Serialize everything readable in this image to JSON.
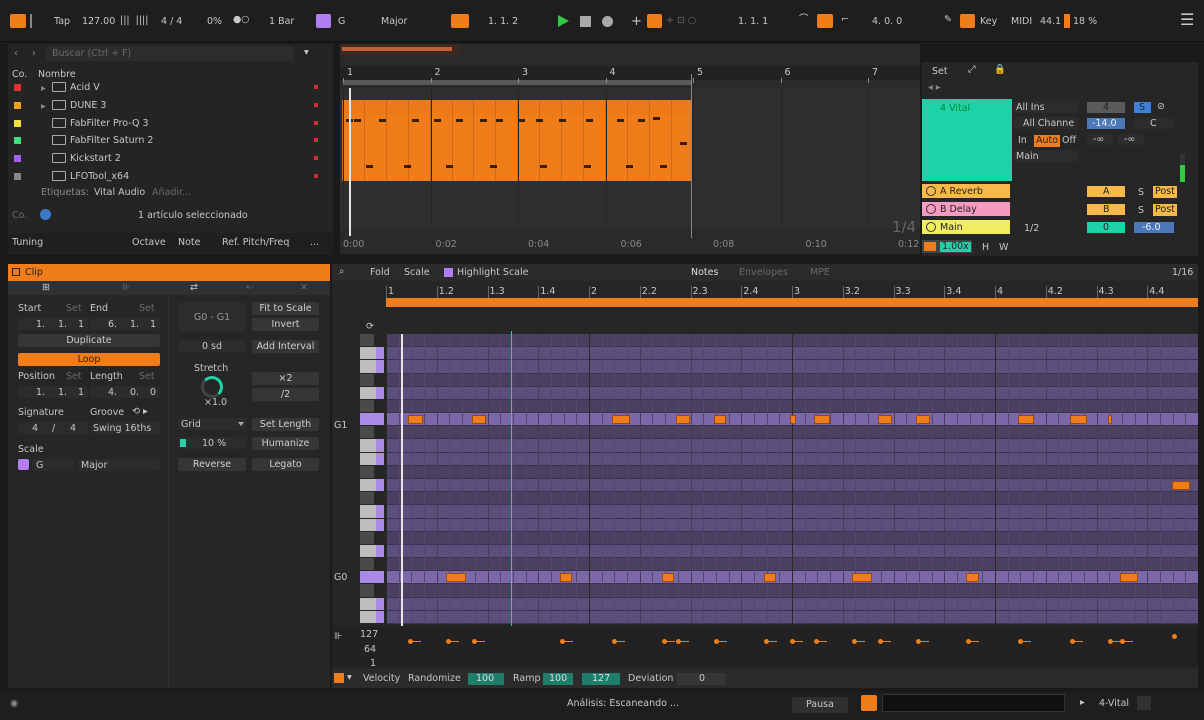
{
  "transport": {
    "tap": "Tap",
    "tempo": "127.00",
    "signature": "4 / 4",
    "swing": "0%",
    "quant": "1 Bar",
    "key_root": "G",
    "key_mode": "Major",
    "position": "1.  1.  2",
    "loop_start": "1.  1.  1",
    "loop_length": "4.  0.  0",
    "key_label": "Key",
    "midi_label": "MIDI",
    "sample_rate": "44.1",
    "cpu": "18 %"
  },
  "browser": {
    "search_placeholder": "Buscar (Ctrl + F)",
    "col_co": "Co.",
    "col_name": "Nombre",
    "items": [
      {
        "name": "Acid V",
        "color": "#e03030"
      },
      {
        "name": "DUNE 3",
        "color": "#f0a020"
      },
      {
        "name": "FabFilter Pro-Q 3",
        "color": "#f0e040"
      },
      {
        "name": "FabFilter Saturn 2",
        "color": "#40e080"
      },
      {
        "name": "Kickstart 2",
        "color": "#a060f0"
      },
      {
        "name": "LFOTool_x64",
        "color": "#888888"
      }
    ],
    "tags_label": "Etiquetas:",
    "tag": "Vital Audio",
    "tag_add": "Añadir...",
    "co2": "Co.",
    "selected": "1 artículo seleccionado",
    "tuning": "Tuning",
    "octave": "Octave",
    "note": "Note",
    "ref": "Ref. Pitch/Freq",
    "more": "..."
  },
  "arrangement": {
    "bars": [
      "1",
      "2",
      "3",
      "4",
      "5",
      "6",
      "7"
    ],
    "times": [
      "0:00",
      "0:02",
      "0:04",
      "0:06",
      "0:08",
      "0:10",
      "0:12"
    ],
    "quant": "1/4"
  },
  "mixer": {
    "set": "Set",
    "track": "4 Vital",
    "input": "All Ins",
    "channel": "All Channe",
    "in": "In",
    "auto": "Auto",
    "off": "Off",
    "out": "Main",
    "track_num": "4",
    "solo": "S",
    "vol": "-14.0",
    "pan": "C",
    "inf1": "-∞",
    "inf2": "-∞",
    "returns": [
      {
        "name": "A Reverb",
        "color": "#f6b94a",
        "send": "A",
        "send_color": "#f6b94a",
        "s": "S",
        "post": "Post"
      },
      {
        "name": "B Delay",
        "color": "#f79ac0",
        "send": "B",
        "send_color": "#f6b94a",
        "s": "S",
        "post": "Post"
      },
      {
        "name": "Main",
        "color": "#f0ee60",
        "send": "0",
        "send_color": "#1fd3a8",
        "s": "",
        "post": ""
      }
    ],
    "main_quant": "1/2",
    "main_vol": "-6.0",
    "speed": "1.00x",
    "h": "H",
    "w": "W"
  },
  "clip": {
    "title": "Clip",
    "start": "Start",
    "set": "Set",
    "end": "End",
    "start_val": [
      "1.",
      "1.",
      "1"
    ],
    "end_val": [
      "6.",
      "1.",
      "1"
    ],
    "duplicate": "Duplicate",
    "loop": "Loop",
    "position": "Position",
    "length": "Length",
    "position_val": [
      "1.",
      "1.",
      "1"
    ],
    "length_val": [
      "4.",
      "0.",
      "0"
    ],
    "signature": "Signature",
    "groove": "Groove",
    "sig_num": "4",
    "sig_den": "4",
    "groove_val": "Swing 16ths",
    "scale": "Scale",
    "scale_root": "G",
    "scale_mode": "Major",
    "range": "G0 - G1",
    "fit": "Fit to Scale",
    "invert": "Invert",
    "sd": "0 sd",
    "add_interval": "Add Interval",
    "stretch": "Stretch",
    "x2": "×2",
    "half": "/2",
    "stretch_val": "×1.0",
    "grid": "Grid",
    "set_length": "Set Length",
    "pct": "10 %",
    "humanize": "Humanize",
    "reverse": "Reverse",
    "legato": "Legato"
  },
  "editor": {
    "fold": "Fold",
    "scale": "Scale",
    "highlight": "Highlight Scale",
    "tabs": [
      "Notes",
      "Envelopes",
      "MPE"
    ],
    "grid": "1/16",
    "ruler": [
      "1",
      "1.2",
      "1.3",
      "1.4",
      "2",
      "2.2",
      "2.3",
      "2.4",
      "3",
      "3.2",
      "3.3",
      "3.4",
      "4",
      "4.2",
      "4.3",
      "4.4"
    ],
    "g1": "G1",
    "g0": "G0",
    "vel_labels": [
      "127",
      "64",
      "1"
    ],
    "velocity": "Velocity",
    "randomize": "Randomize",
    "rand_val": "100",
    "ramp": "Ramp",
    "ramp_a": "100",
    "ramp_b": "127",
    "deviation": "Deviation",
    "dev_val": "0"
  },
  "status": {
    "analysis": "Análisis: Escaneando ...",
    "pause": "Pausa",
    "track": "4-Vital"
  },
  "colors": {
    "accent": "#f07d1a",
    "teal": "#1fd3a8",
    "purple": "#a98ae6"
  }
}
